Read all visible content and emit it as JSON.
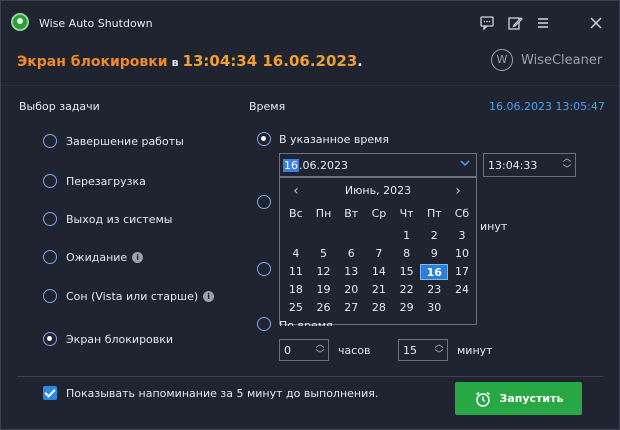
{
  "window": {
    "title": "Wise Auto Shutdown"
  },
  "header": {
    "label": "Экран блокировки",
    "separator": "в",
    "time": "13:04:34 16.06.2023",
    "dot": "."
  },
  "brand": {
    "logo": "W",
    "name": "WiseCleaner"
  },
  "task_section": {
    "label": "Выбор задачи",
    "options": [
      {
        "label": "Завершение работы",
        "checked": false
      },
      {
        "label": "Перезагрузка",
        "checked": false
      },
      {
        "label": "Выход из системы",
        "checked": false
      },
      {
        "label": "Ожидание",
        "checked": false,
        "info": true
      },
      {
        "label": "Сон (Vista или старше)",
        "checked": false,
        "info": true
      },
      {
        "label": "Экран блокировки",
        "checked": true
      }
    ]
  },
  "time_section": {
    "label": "Время",
    "now": "16.06.2023 13:05:47",
    "option_specified": "В указанное время",
    "date_value_selected": "16",
    "date_value_rest": ".06.2023",
    "time_value": "13:04:33",
    "idle_label": "По время простоя",
    "stray_fragment": "инут",
    "idle_hours": "0",
    "idle_hours_unit": "часов",
    "idle_minutes": "15",
    "idle_minutes_unit": "минут"
  },
  "calendar": {
    "month_label": "Июнь, 2023",
    "weekdays": [
      "Вс",
      "Пн",
      "Вт",
      "Ср",
      "Чт",
      "Пт",
      "Сб"
    ],
    "weeks": [
      [
        "",
        "",
        "",
        "",
        "1",
        "2",
        "3"
      ],
      [
        "4",
        "5",
        "6",
        "7",
        "8",
        "9",
        "10"
      ],
      [
        "11",
        "12",
        "13",
        "14",
        "15",
        "16",
        "17"
      ],
      [
        "18",
        "19",
        "20",
        "21",
        "22",
        "23",
        "24"
      ],
      [
        "25",
        "26",
        "27",
        "28",
        "29",
        "30",
        ""
      ]
    ],
    "today": "16"
  },
  "footer": {
    "reminder_checked": true,
    "reminder_text": "Показывать напоминание за 5 минут до выполнения.",
    "start_label": "Запустить"
  },
  "colors": {
    "accent_orange": "#f08a24",
    "accent_blue": "#4aa3f0",
    "start_green": "#28a745",
    "window_bg": "#1f2430"
  },
  "icons": {
    "titlebar": [
      "chat-icon",
      "edit-icon",
      "menu-icon",
      "close-icon"
    ],
    "start": "alarm-clock-icon"
  }
}
